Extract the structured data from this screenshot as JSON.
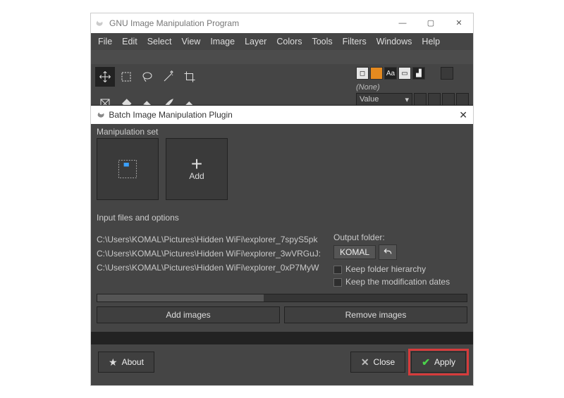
{
  "app": {
    "title": "GNU Image Manipulation Program"
  },
  "win_controls": {
    "min": "—",
    "max": "▢",
    "close": "✕"
  },
  "menu": {
    "file": "File",
    "edit": "Edit",
    "select": "Select",
    "view": "View",
    "image": "Image",
    "layer": "Layer",
    "colors": "Colors",
    "tools": "Tools",
    "filters": "Filters",
    "windows": "Windows",
    "help": "Help"
  },
  "right_dock": {
    "none": "(None)",
    "value": "Value",
    "aa": "Aa"
  },
  "dialog": {
    "title": "Batch Image Manipulation Plugin",
    "manip_label": "Manipulation set",
    "add_label": "Add",
    "input_label": "Input files and options",
    "files": [
      "C:\\Users\\KOMAL\\Pictures\\Hidden WiFi\\explorer_7spyS5pk",
      "C:\\Users\\KOMAL\\Pictures\\Hidden WiFi\\explorer_3wVRGuJ:",
      "C:\\Users\\KOMAL\\Pictures\\Hidden WiFi\\explorer_0xP7MyW"
    ],
    "output_label": "Output folder:",
    "output_value": "KOMAL",
    "keep_hierarchy": "Keep folder hierarchy",
    "keep_dates": "Keep the modification dates",
    "add_images": "Add images",
    "remove_images": "Remove images",
    "about": "About",
    "close": "Close",
    "apply": "Apply"
  }
}
